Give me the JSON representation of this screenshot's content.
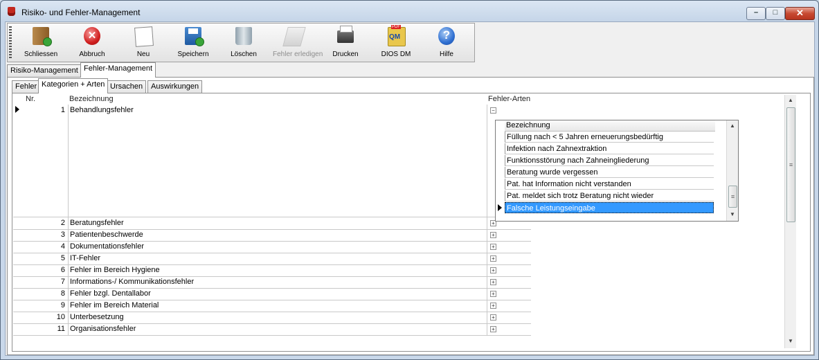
{
  "window": {
    "title": "Risiko- und Fehler-Management",
    "controls": {
      "minimize": "–",
      "maximize": "□",
      "close": "✕"
    }
  },
  "toolbar": {
    "buttons": [
      {
        "label": "Schliessen",
        "icon": "exit-door-icon",
        "enabled": true
      },
      {
        "label": "Abbruch",
        "icon": "cancel-icon",
        "enabled": true
      },
      {
        "label": "Neu",
        "icon": "new-document-icon",
        "enabled": true
      },
      {
        "label": "Speichern",
        "icon": "save-icon",
        "enabled": true
      },
      {
        "label": "Löschen",
        "icon": "delete-bin-icon",
        "enabled": true
      },
      {
        "label": "Fehler erledigen",
        "icon": "done-icon",
        "enabled": false
      },
      {
        "label": "Drucken",
        "icon": "printer-icon",
        "enabled": true
      },
      {
        "label": "DIOS DM",
        "icon": "qm-pdf-icon",
        "enabled": true
      },
      {
        "label": "Hilfe",
        "icon": "help-icon",
        "enabled": true
      }
    ]
  },
  "main_tabs": [
    {
      "label": "Risiko-Management",
      "active": false
    },
    {
      "label": "Fehler-Management",
      "active": true
    }
  ],
  "sub_tabs": [
    {
      "label": "Fehler",
      "active": false
    },
    {
      "label": "Kategorien + Arten",
      "active": true
    },
    {
      "label": "Ursachen",
      "active": false
    },
    {
      "label": "Auswirkungen",
      "active": false
    }
  ],
  "grid": {
    "columns": {
      "nr": "Nr.",
      "bezeichnung": "Bezeichnung",
      "fehler_arten": "Fehler-Arten"
    },
    "rows": [
      {
        "nr": "1",
        "bezeichnung": "Behandlungsfehler",
        "expanded": true
      },
      {
        "nr": "2",
        "bezeichnung": "Beratungsfehler",
        "expanded": false
      },
      {
        "nr": "3",
        "bezeichnung": "Patientenbeschwerde",
        "expanded": false
      },
      {
        "nr": "4",
        "bezeichnung": "Dokumentationsfehler",
        "expanded": false
      },
      {
        "nr": "5",
        "bezeichnung": "IT-Fehler",
        "expanded": false
      },
      {
        "nr": "6",
        "bezeichnung": "Fehler im Bereich Hygiene",
        "expanded": false
      },
      {
        "nr": "7",
        "bezeichnung": "Informations-/ Kommunikationsfehler",
        "expanded": false
      },
      {
        "nr": "8",
        "bezeichnung": "Fehler bzgl. Dentallabor",
        "expanded": false
      },
      {
        "nr": "9",
        "bezeichnung": "Fehler im Bereich Material",
        "expanded": false
      },
      {
        "nr": "10",
        "bezeichnung": "Unterbesetzung",
        "expanded": false
      },
      {
        "nr": "11",
        "bezeichnung": "Organisationsfehler",
        "expanded": false
      }
    ],
    "expand_symbol": "+",
    "collapse_symbol": "−"
  },
  "child_grid": {
    "column": "Bezeichnung",
    "rows": [
      "Füllung nach < 5 Jahren erneuerungsbedürftig",
      "Infektion nach Zahnextraktion",
      "Funktionsstörung nach Zahneingliederung",
      "Beratung wurde vergessen",
      "Pat. hat Information nicht verstanden",
      "Pat. meldet sich trotz Beratung nicht wieder",
      "Falsche Leistungseingabe"
    ],
    "selected_index": 6
  },
  "scroll": {
    "up": "▲",
    "down": "▼",
    "grip": "≡"
  },
  "colors": {
    "selection": "#3399ff",
    "close_button": "#c74a32",
    "titlebar": "#c5d5e8"
  }
}
